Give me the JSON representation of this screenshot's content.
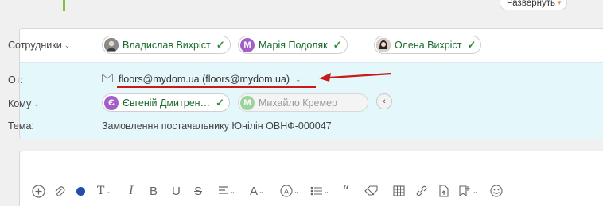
{
  "top": {
    "expand_label": "Развернуть"
  },
  "employees": {
    "label": "Сотрудники",
    "chips": [
      {
        "name": "Владислав Вихріст",
        "avatar": "photo"
      },
      {
        "name": "Марія Подоляк",
        "avatar": "М",
        "avatar_color": "#a45fc7"
      },
      {
        "name": "Олена Вихріст",
        "avatar": "photo"
      }
    ]
  },
  "from": {
    "label": "От:",
    "value": "floors@mydom.ua (floors@mydom.ua)"
  },
  "to": {
    "label": "Кому",
    "chips": [
      {
        "name": "Євгеній Дмитрен…",
        "avatar": "Є",
        "avatar_color": "#a45fc7",
        "active": true
      },
      {
        "name": "Михайло Кремер",
        "avatar": "М",
        "avatar_color": "#9ed39e",
        "active": false
      }
    ]
  },
  "subject": {
    "label": "Тема:",
    "value": "Замовлення постачальнику Юнілін ОВНФ-000047"
  },
  "colors": {
    "accent_green": "#7cc243",
    "annotation_red": "#c91a1a",
    "text_color_swatch": "#1f4fa8"
  },
  "toolbar": {
    "icons": [
      "add-icon",
      "attach-icon",
      "text-color-icon",
      "font-size-icon",
      "italic-icon",
      "bold-icon",
      "underline-icon",
      "strikethrough-icon",
      "align-icon",
      "font-icon",
      "mention-icon",
      "list-icon",
      "quote-icon",
      "clear-format-icon",
      "table-icon",
      "link-icon",
      "file-icon",
      "checklist-icon",
      "emoji-icon"
    ]
  }
}
